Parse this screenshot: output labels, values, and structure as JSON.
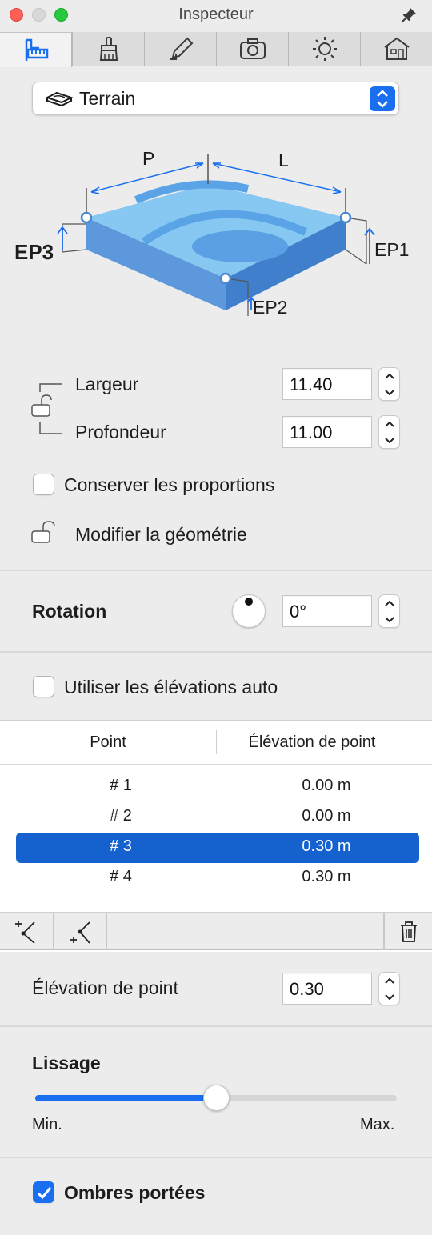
{
  "window": {
    "title": "Inspecteur"
  },
  "tabs": [
    {
      "icon": "caliper-ruler-icon",
      "active": true
    },
    {
      "icon": "paint-brush-icon",
      "active": false
    },
    {
      "icon": "pencil-icon",
      "active": false
    },
    {
      "icon": "camera-icon",
      "active": false
    },
    {
      "icon": "sun-icon",
      "active": false
    },
    {
      "icon": "house-icon",
      "active": false
    }
  ],
  "object_type": {
    "label": "Terrain",
    "icon": "terrain-icon"
  },
  "diagram": {
    "labels": {
      "p": "P",
      "l": "L",
      "ep1": "EP1",
      "ep2": "EP2",
      "ep3": "EP3"
    }
  },
  "dimensions": {
    "width_label": "Largeur",
    "width_value": "11.40",
    "depth_label": "Profondeur",
    "depth_value": "11.00",
    "keep_proportions_label": "Conserver les proportions",
    "keep_proportions_checked": false,
    "modify_geometry_label": "Modifier la géométrie"
  },
  "rotation": {
    "label": "Rotation",
    "value": "0°"
  },
  "auto_elevations": {
    "label": "Utiliser les élévations auto",
    "checked": false
  },
  "points_table": {
    "headers": {
      "point": "Point",
      "elevation": "Élévation de point"
    },
    "rows": [
      {
        "point": "# 1",
        "elevation": "0.00 m",
        "selected": false
      },
      {
        "point": "# 2",
        "elevation": "0.00 m",
        "selected": false
      },
      {
        "point": "# 3",
        "elevation": "0.30 m",
        "selected": true
      },
      {
        "point": "# 4",
        "elevation": "0.30 m",
        "selected": false
      }
    ]
  },
  "point_elevation": {
    "label": "Élévation de point",
    "value": "0.30"
  },
  "smoothing": {
    "label": "Lissage",
    "min_label": "Min.",
    "max_label": "Max.",
    "value_fraction": 0.5
  },
  "shadows": {
    "label": "Ombres portées",
    "checked": true
  },
  "colors": {
    "accent": "#1a6ff0",
    "selection": "#1562cf",
    "terrain_top": "#7ec3f0",
    "terrain_side": "#4a86d0"
  }
}
